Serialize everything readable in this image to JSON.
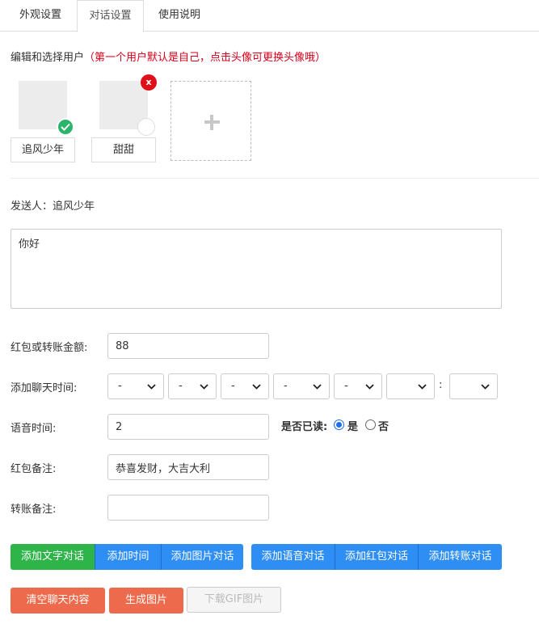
{
  "tabs": [
    {
      "label": "外观设置"
    },
    {
      "label": "对话设置"
    },
    {
      "label": "使用说明"
    }
  ],
  "active_tab": "对话设置",
  "users_section": {
    "title": "编辑和选择用户",
    "hint": "（第一个用户默认是自己，点击头像可更换头像哦）",
    "users": [
      {
        "name": "追风少年",
        "selected": true
      },
      {
        "name": "甜甜",
        "selected": false,
        "delete_label": "x"
      }
    ],
    "add_icon": "plus-icon"
  },
  "sender": {
    "label": "发送人：",
    "name": "追风少年"
  },
  "message": {
    "value": "你好"
  },
  "form": {
    "amount": {
      "label": "红包或转账金额:",
      "value": "88"
    },
    "chat_time": {
      "label": "添加聊天时间:",
      "selects": [
        "-",
        "-",
        "-",
        "-",
        "-",
        "",
        ""
      ],
      "separator": ":"
    },
    "voice_time": {
      "label": "语音时间:",
      "value": "2"
    },
    "read_status": {
      "label": "是否已读:",
      "options": [
        "是",
        "否"
      ],
      "selected": "是"
    },
    "red_packet_note": {
      "label": "红包备注:",
      "value": "恭喜发财，大吉大利"
    },
    "transfer_note": {
      "label": "转账备注:",
      "value": ""
    }
  },
  "buttons_row1": {
    "add_text": "添加文字对话",
    "add_time": "添加时间",
    "add_image": "添加图片对话",
    "add_voice": "添加语音对话",
    "add_red_packet": "添加红包对话",
    "add_transfer": "添加转账对话"
  },
  "buttons_row2": {
    "clear": "清空聊天内容",
    "generate": "生成图片",
    "download_gif": "下载GIF图片"
  },
  "colors": {
    "hint_red": "#d9001b",
    "check_green": "#2bb46a",
    "delete_red": "#e0101a",
    "btn_green": "#2fb44a",
    "btn_blue": "#2f8ef3",
    "btn_red": "#ee6a4c",
    "radio_blue": "#1e6fe8"
  }
}
